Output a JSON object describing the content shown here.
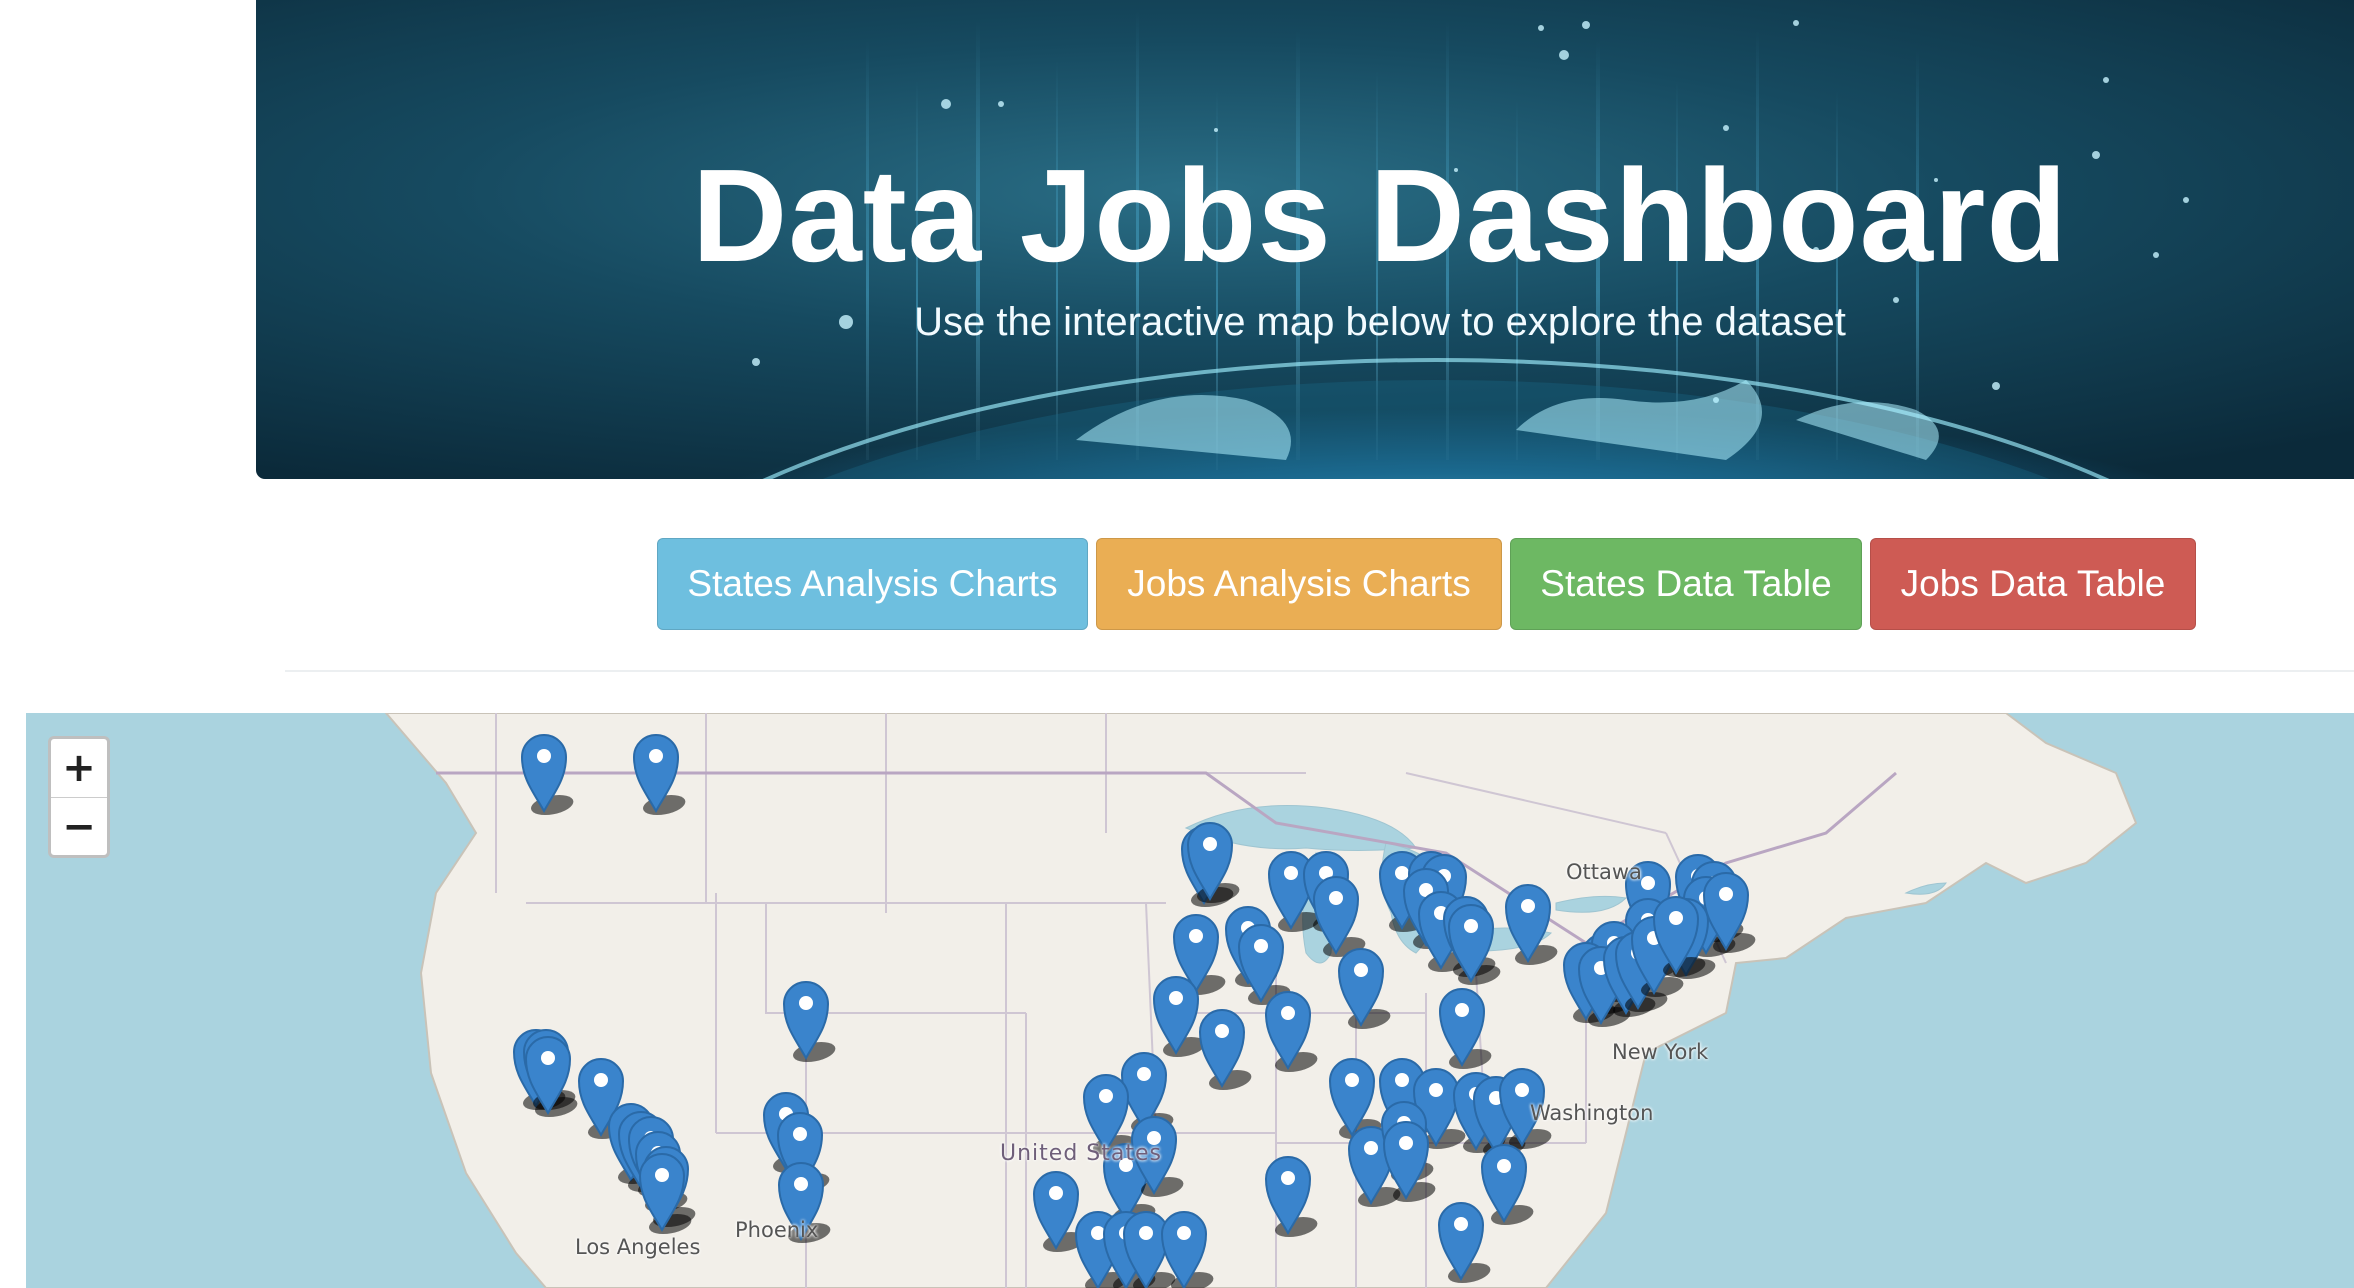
{
  "header": {
    "title": "Data Jobs Dashboard",
    "subtitle": "Use the interactive map below to explore the dataset"
  },
  "nav_buttons": [
    {
      "label": "States Analysis Charts",
      "color": "#6ebfdf"
    },
    {
      "label": "Jobs Analysis Charts",
      "color": "#eaae54"
    },
    {
      "label": "States Data Table",
      "color": "#6db863"
    },
    {
      "label": "Jobs Data Table",
      "color": "#ce5b54"
    }
  ],
  "map": {
    "zoom_in_label": "+",
    "zoom_out_label": "−",
    "labels": {
      "ottawa": "Ottawa",
      "new_york": "New York",
      "washington": "Washington",
      "united_states": "United States",
      "los_angeles": "Los Angeles",
      "phoenix": "Phoenix"
    },
    "marker_icon": "map-pin-icon",
    "colors": {
      "water": "#aad3df",
      "land": "#f2efe9",
      "marker": "#3a84cc"
    }
  }
}
